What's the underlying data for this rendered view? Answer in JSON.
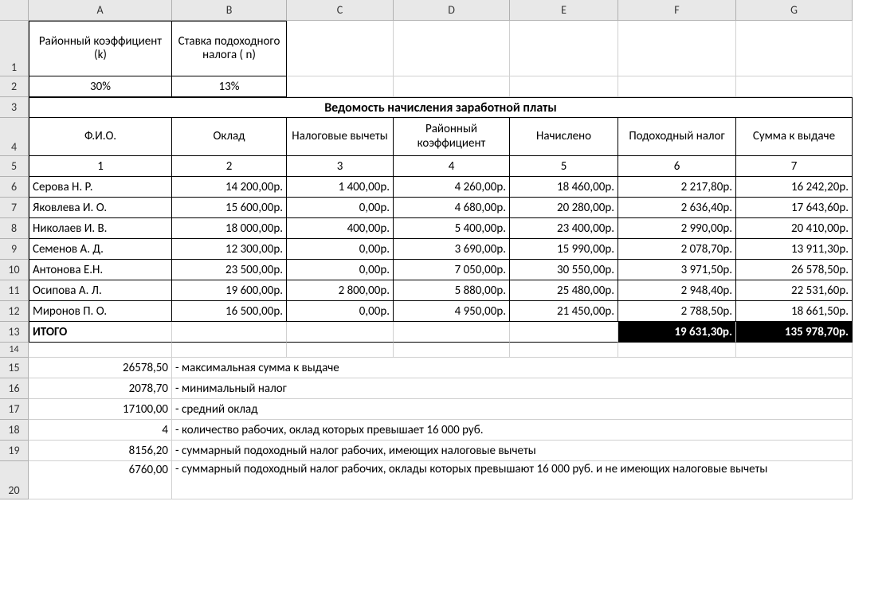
{
  "cols": [
    "A",
    "B",
    "C",
    "D",
    "E",
    "F",
    "G"
  ],
  "param": {
    "coef_label": "Районный коэффициент (k)",
    "tax_label": "Ставка подоходного налога ( n)",
    "coef_value": "30%",
    "tax_value": "13%"
  },
  "title": "Ведомость начисления заработной платы",
  "headers": {
    "c1": "Ф.И.О.",
    "c2": "Оклад",
    "c3": "Налоговые вычеты",
    "c4": "Районный коэффициент",
    "c5": "Начислено",
    "c6": "Подоходный налог",
    "c7": "Сумма к выдаче"
  },
  "colnums": {
    "n1": "1",
    "n2": "2",
    "n3": "3",
    "n4": "4",
    "n5": "5",
    "n6": "6",
    "n7": "7"
  },
  "rows": [
    {
      "name": "Серова Н. Р.",
      "salary": "14 200,00р.",
      "deduct": "1 400,00р.",
      "coef": "4 260,00р.",
      "accr": "18 460,00р.",
      "tax": "2 217,80р.",
      "pay": "16 242,20р."
    },
    {
      "name": "Яковлева И. О.",
      "salary": "15 600,00р.",
      "deduct": "0,00р.",
      "coef": "4 680,00р.",
      "accr": "20 280,00р.",
      "tax": "2 636,40р.",
      "pay": "17 643,60р."
    },
    {
      "name": "Николаев И. В.",
      "salary": "18 000,00р.",
      "deduct": "400,00р.",
      "coef": "5 400,00р.",
      "accr": "23 400,00р.",
      "tax": "2 990,00р.",
      "pay": "20 410,00р."
    },
    {
      "name": "Семенов А. Д.",
      "salary": "12 300,00р.",
      "deduct": "0,00р.",
      "coef": "3 690,00р.",
      "accr": "15 990,00р.",
      "tax": "2 078,70р.",
      "pay": "13 911,30р."
    },
    {
      "name": "Антонова Е.Н.",
      "salary": "23 500,00р.",
      "deduct": "0,00р.",
      "coef": "7 050,00р.",
      "accr": "30 550,00р.",
      "tax": "3 971,50р.",
      "pay": "26 578,50р."
    },
    {
      "name": "Осипова А. Л.",
      "salary": "19 600,00р.",
      "deduct": "2 800,00р.",
      "coef": "5 880,00р.",
      "accr": "25 480,00р.",
      "tax": "2 948,40р.",
      "pay": "22 531,60р."
    },
    {
      "name": "Миронов П. О.",
      "salary": "16 500,00р.",
      "deduct": "0,00р.",
      "coef": "4 950,00р.",
      "accr": "21 450,00р.",
      "tax": "2 788,50р.",
      "pay": "18 661,50р."
    }
  ],
  "total": {
    "label": "ИТОГО",
    "tax": "19 631,30р.",
    "pay": "135 978,70р."
  },
  "stats": [
    {
      "val": "26578,50",
      "desc": "- максимальная сумма к выдаче"
    },
    {
      "val": "2078,70",
      "desc": "- минимальный налог"
    },
    {
      "val": "17100,00",
      "desc": "- средний оклад"
    },
    {
      "val": "4",
      "desc": "- количество рабочих, оклад которых превышает 16 000 руб."
    },
    {
      "val": "8156,20",
      "desc": "- суммарный подоходный налог рабочих, имеющих налоговые вычеты"
    },
    {
      "val": "6760,00",
      "desc": "- суммарный подоходный налог рабочих, оклады которых превышают 16 000 руб. и не имеющих налоговые вычеты"
    }
  ]
}
